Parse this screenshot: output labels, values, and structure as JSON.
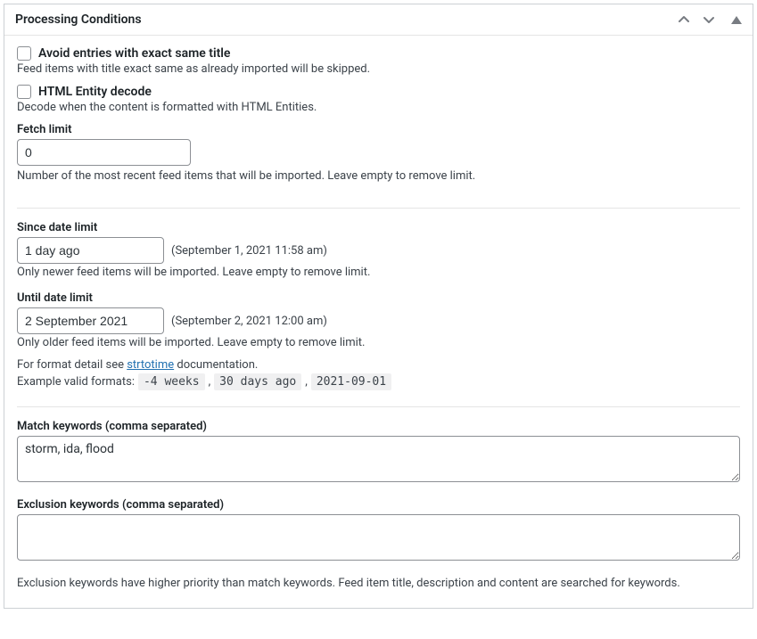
{
  "header": {
    "title": "Processing Conditions"
  },
  "avoid_same_title": {
    "label": "Avoid entries with exact same title",
    "desc": "Feed items with title exact same as already imported will be skipped."
  },
  "entity_decode": {
    "label": "HTML Entity decode",
    "desc": "Decode when the content is formatted with HTML Entities."
  },
  "fetch_limit": {
    "label": "Fetch limit",
    "value": "0",
    "desc": "Number of the most recent feed items that will be imported. Leave empty to remove limit."
  },
  "since_date": {
    "label": "Since date limit",
    "value": "1 day ago",
    "resolved": "(September 1, 2021 11:58 am)",
    "desc": "Only newer feed items will be imported. Leave empty to remove limit."
  },
  "until_date": {
    "label": "Until date limit",
    "value": "2 September 2021",
    "resolved": "(September 2, 2021 12:00 am)",
    "desc": "Only older feed items will be imported. Leave empty to remove limit."
  },
  "format_note": {
    "prefix": "For format detail see ",
    "link": "strtotime",
    "suffix": " documentation.",
    "examples_label": "Example valid formats: ",
    "ex1": "-4 weeks",
    "ex2": "30 days ago",
    "ex3": "2021-09-01",
    "sep": ","
  },
  "match_kw": {
    "label": "Match keywords (comma separated)",
    "value": "storm, ida, flood"
  },
  "exclusion_kw": {
    "label": "Exclusion keywords (comma separated)",
    "value": ""
  },
  "footer_note": "Exclusion keywords have higher priority than match keywords. Feed item title, description and content are searched for keywords."
}
